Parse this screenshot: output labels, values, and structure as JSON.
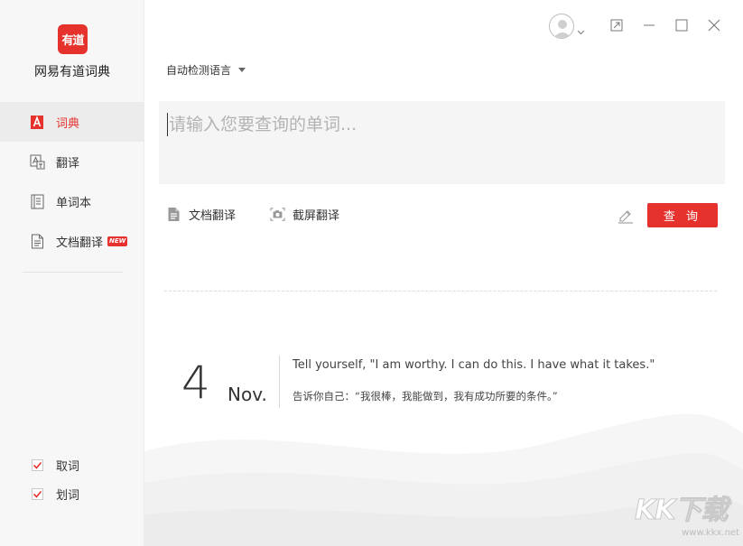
{
  "sidebar": {
    "logo_text": "有道",
    "app_name": "网易有道词典",
    "items": [
      {
        "label": "词典",
        "icon": "dictionary-icon"
      },
      {
        "label": "翻译",
        "icon": "translate-icon"
      },
      {
        "label": "单词本",
        "icon": "wordbook-icon"
      },
      {
        "label": "文档翻译",
        "icon": "document-icon",
        "badge": "NEW"
      }
    ],
    "checks": [
      {
        "label": "取词",
        "checked": true
      },
      {
        "label": "划词",
        "checked": true
      }
    ]
  },
  "main": {
    "language_select": "自动检测语言",
    "search_placeholder": "请输入您要查询的单词...",
    "tools": {
      "doc_translate": "文档翻译",
      "screenshot_translate": "截屏翻译"
    },
    "query_button": "查 询"
  },
  "daily": {
    "day": "4",
    "month": "Nov.",
    "quote_en": "Tell yourself, \"I am worthy. I can do this. I have what it takes.\"",
    "quote_zh": "告诉你自己：“我很棒，我能做到，我有成功所要的条件。”"
  },
  "watermark": {
    "brand": "KK下载",
    "url": "www.kkx.net"
  },
  "colors": {
    "accent": "#e5322d",
    "sidebar_bg": "#f7f7f7",
    "search_bg": "#f5f5f6"
  }
}
